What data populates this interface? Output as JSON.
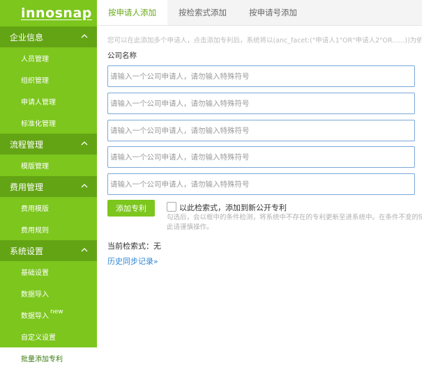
{
  "logo": "innosnap",
  "sidebar": {
    "groups": [
      {
        "label": "企业信息",
        "items": [
          "人员管理",
          "组织管理",
          "申请人管理",
          "标准化管理"
        ]
      },
      {
        "label": "流程管理",
        "items": [
          "模版管理"
        ]
      },
      {
        "label": "费用管理",
        "items": [
          "费用模版",
          "费用规则"
        ]
      },
      {
        "label": "系统设置",
        "items": [
          "基础设置",
          "数据导入",
          "数据导入",
          "自定义设置",
          "批量添加专利"
        ]
      }
    ],
    "new_badge": "new"
  },
  "tabs": [
    "按申请人添加",
    "按检索式添加",
    "按申请号添加"
  ],
  "hint": "您可以在此添加多个申请人，点击添加专利后，系统将以(anc_facet:(\"申请人1\"OR\"申请人2\"OR......))为依据将智",
  "form": {
    "company_label": "公司名称",
    "placeholder": "请输入一个公司申请人，请勿输入特殊符号"
  },
  "add_button": "添加专利",
  "checkbox_label": "以此检索式，添加到新公开专利",
  "desc_line1": "勾选后，会以框中的条件检测，将系统中不存在的专利更新至进系统中。在条件不变的情况",
  "desc_line2": "此请谨慎操作。",
  "current_query_label": "当前检索式：无",
  "history_link": "历史同步记录"
}
